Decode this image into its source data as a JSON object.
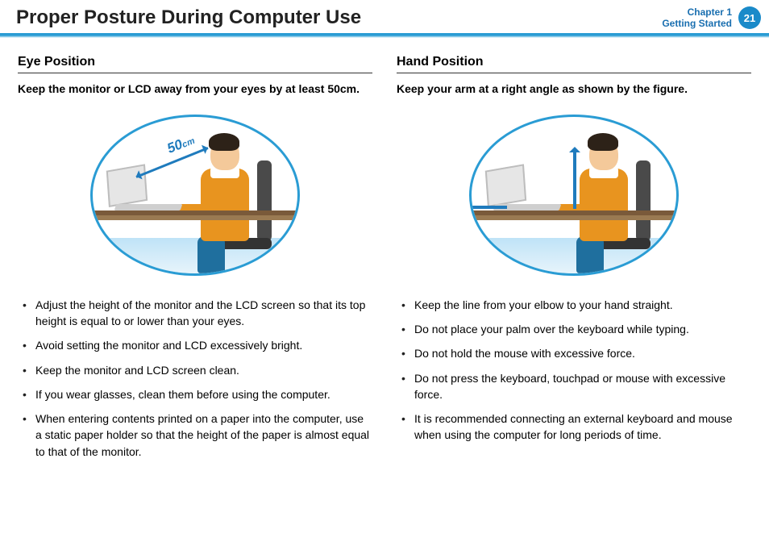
{
  "header": {
    "title": "Proper Posture During Computer Use",
    "chapter_line1": "Chapter 1",
    "chapter_line2": "Getting Started",
    "page_number": "21"
  },
  "left": {
    "heading": "Eye Position",
    "sub": "Keep the monitor or LCD away from your eyes by at least 50cm.",
    "distance_value": "50",
    "distance_unit": "cm",
    "bullets": [
      "Adjust the height of the monitor and the LCD screen so that its top height is equal to or lower than your eyes.",
      "Avoid setting the monitor and LCD excessively bright.",
      "Keep the monitor and LCD screen clean.",
      "If you wear glasses, clean them before using the computer.",
      "When entering contents printed on a paper into the computer, use a static paper holder so that the height of the paper is almost equal to that of the monitor."
    ]
  },
  "right": {
    "heading": "Hand Position",
    "sub": "Keep your arm at a right angle as shown by the figure.",
    "bullets": [
      "Keep the line from your elbow to your hand straight.",
      "Do not place your palm over the keyboard while typing.",
      "Do not hold the mouse with excessive force.",
      "Do not press the keyboard, touchpad or mouse with excessive force.",
      "It is recommended connecting an external keyboard and mouse when using the computer for long periods of time."
    ]
  }
}
